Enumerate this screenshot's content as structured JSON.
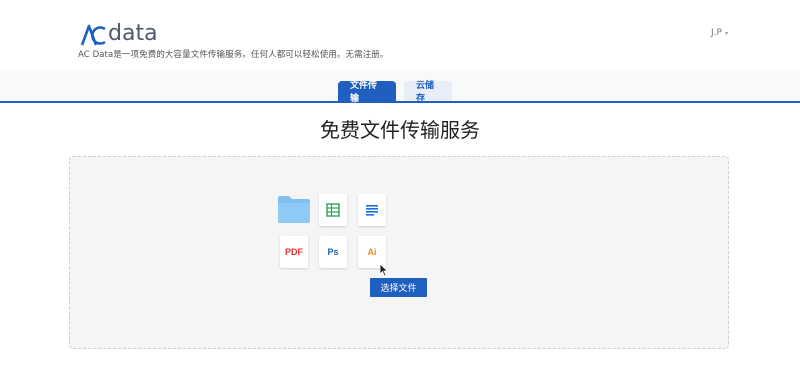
{
  "header": {
    "logo_text": "data",
    "logo_mark": "AC",
    "tagline": "AC Data是一项免费的大容量文件传输服务。任何人都可以轻松使用。无需注册。",
    "user_name": "J.P",
    "user_caret": "▾"
  },
  "tabs": [
    {
      "label": "文件传输",
      "active": true
    },
    {
      "label": "云储存",
      "active": false
    }
  ],
  "main": {
    "title": "免费文件传输服务",
    "select_button": "选择文件"
  },
  "file_icons": [
    {
      "name": "folder-icon",
      "label": ""
    },
    {
      "name": "spreadsheet-icon",
      "label": ""
    },
    {
      "name": "document-icon",
      "label": ""
    },
    {
      "name": "pdf-icon",
      "label": "PDF"
    },
    {
      "name": "photoshop-icon",
      "label": "Ps"
    },
    {
      "name": "illustrator-icon",
      "label": "Ai"
    }
  ],
  "colors": {
    "primary": "#1f5fbf",
    "pdf": "#e0312f",
    "sheet": "#2e9e5b",
    "ai": "#f08a24",
    "folder": "#7fbff2"
  }
}
